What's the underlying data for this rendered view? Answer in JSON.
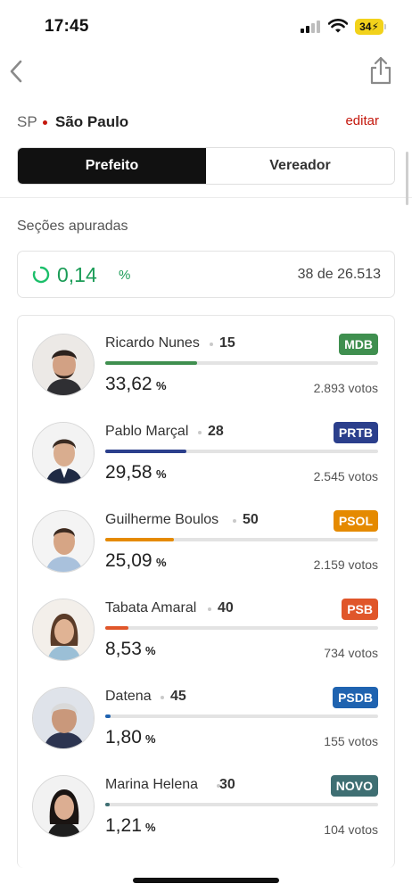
{
  "status_bar": {
    "time": "17:45",
    "battery": "34"
  },
  "header": {
    "state": "SP",
    "city": "São Paulo",
    "edit_label": "editar"
  },
  "tabs": [
    {
      "label": "Prefeito",
      "active": true
    },
    {
      "label": "Vereador",
      "active": false
    }
  ],
  "sections": {
    "label": "Seções apuradas",
    "percent": "0,14",
    "percent_sign": "%",
    "count_text": "38 de 26.513"
  },
  "candidates": [
    {
      "name": "Ricardo Nunes",
      "number": "15",
      "party": "MDB",
      "party_color": "#3f8f4f",
      "bar_color": "#3f8f4f",
      "percent": "33,62",
      "progress": 0.3362,
      "votes": "2.893 votos",
      "name_width": 109
    },
    {
      "name": "Pablo Marçal",
      "number": "28",
      "party": "PRTB",
      "party_color": "#2b3f8c",
      "bar_color": "#2b3f8c",
      "percent": "29,58",
      "progress": 0.2958,
      "votes": "2.545 votos",
      "name_width": 96
    },
    {
      "name": "Guilherme Boulos",
      "number": "50",
      "party": "PSOL",
      "party_color": "#e58a00",
      "bar_color": "#e58a00",
      "percent": "25,09",
      "progress": 0.2509,
      "votes": "2.159 votos",
      "name_width": 135
    },
    {
      "name": "Tabata Amaral",
      "number": "40",
      "party": "PSB",
      "party_color": "#e0562a",
      "bar_color": "#e0562a",
      "percent": "8,53",
      "progress": 0.0853,
      "votes": "734 votos",
      "name_width": 107
    },
    {
      "name": "Datena",
      "number": "45",
      "party": "PSDB",
      "party_color": "#1f63b0",
      "bar_color": "#1f63b0",
      "percent": "1,80",
      "progress": 0.018,
      "votes": "155 votos",
      "name_width": 54
    },
    {
      "name": "Marina Helena",
      "number": "30",
      "party": "NOVO",
      "party_color": "#3f6f73",
      "bar_color": "#3f6f73",
      "percent": "1,21",
      "progress": 0.0121,
      "votes": "104 votos",
      "name_width": 117
    }
  ],
  "percent_unit": "%"
}
